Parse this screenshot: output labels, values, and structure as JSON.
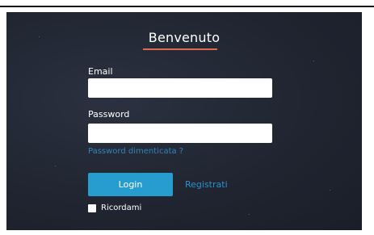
{
  "login_form": {
    "title": "Benvenuto",
    "email_label": "Email",
    "email_value": "",
    "password_label": "Password",
    "password_value": "",
    "forgot_password": "Password dimenticata ?",
    "login_button": "Login",
    "register_link": "Registrati",
    "remember_label": "Ricordami",
    "remember_checked": false
  },
  "colors": {
    "panel_background": "#232835",
    "accent_underline": "#e06a4e",
    "button": "#279ccf",
    "link": "#2f86b8"
  }
}
